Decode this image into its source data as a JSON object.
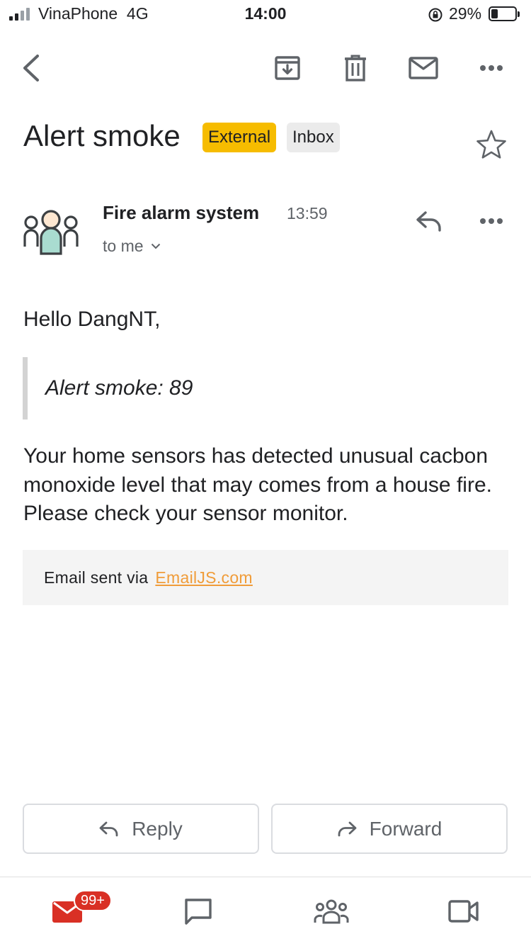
{
  "status_bar": {
    "carrier": "VinaPhone",
    "network": "4G",
    "time": "14:00",
    "battery_percent": "29%",
    "battery_level": 0.29,
    "signal_bars_active": 2
  },
  "toolbar": {
    "icons": [
      "back-arrow-icon",
      "archive-icon",
      "trash-icon",
      "mail-icon",
      "more-icon"
    ]
  },
  "email": {
    "subject": "Alert smoke",
    "labels": [
      "External",
      "Inbox"
    ],
    "label_colors": {
      "External": "#f6bc00",
      "Inbox": "#ebebeb"
    },
    "sender": "Fire alarm system",
    "time": "13:59",
    "recipient": "to me",
    "greeting": "Hello DangNT,",
    "quote": "Alert smoke: 89",
    "body": "Your home sensors has detected unusual cacbon monoxide level that may comes from a house fire. Please check your sensor monitor.",
    "footer_prefix": "Email sent via",
    "footer_link": "EmailJS.com",
    "link_color": "#f09c39"
  },
  "actions": {
    "reply": "Reply",
    "forward": "Forward"
  },
  "bottom_nav": {
    "mail_badge": "99+",
    "items": [
      "mail-icon",
      "chat-icon",
      "spaces-icon",
      "meet-icon"
    ],
    "accent": "#d93025"
  }
}
